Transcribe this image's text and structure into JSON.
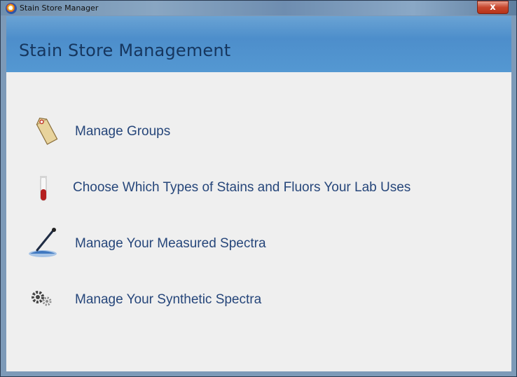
{
  "window": {
    "title": "Stain Store Manager",
    "close_label": "x"
  },
  "header": {
    "title": "Stain Store Management"
  },
  "menu": {
    "items": [
      {
        "label": "Manage Groups",
        "icon": "tag-icon"
      },
      {
        "label": "Choose Which Types of Stains and Fluors Your Lab Uses",
        "icon": "test-tube-icon"
      },
      {
        "label": "Manage Your Measured Spectra",
        "icon": "dropper-icon"
      },
      {
        "label": "Manage Your Synthetic Spectra",
        "icon": "gears-icon"
      }
    ]
  },
  "colors": {
    "header_bg": "#4d8ecb",
    "header_text": "#16365e",
    "link_text": "#26467a",
    "content_bg": "#efefef"
  }
}
